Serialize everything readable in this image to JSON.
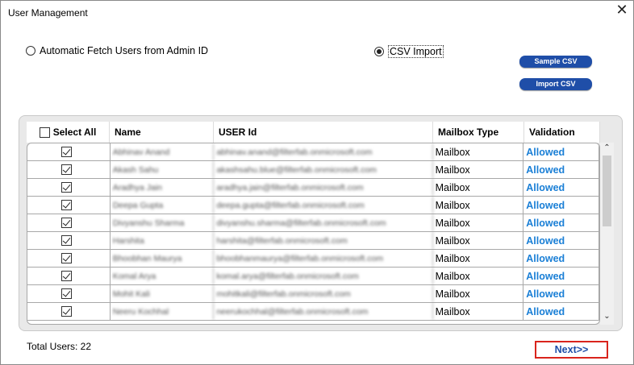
{
  "window": {
    "title": "User Management"
  },
  "options": {
    "auto_fetch_label": "Automatic Fetch Users from Admin ID",
    "csv_import_label": "CSV Import",
    "selected": "csv_import"
  },
  "buttons": {
    "sample_csv": "Sample CSV",
    "import_csv": "Import CSV",
    "next": "Next>>"
  },
  "table": {
    "columns": [
      "Select All",
      "Name",
      "USER Id",
      "Mailbox Type",
      "Validation"
    ],
    "rows": [
      {
        "checked": true,
        "name": "Abhinav Anand",
        "user_id": "abhinav.anand@filterfab.onmicrosoft.com",
        "mailbox_type": "Mailbox",
        "validation": "Allowed"
      },
      {
        "checked": true,
        "name": "Akash Sahu",
        "user_id": "akashsahu.blue@filterfab.onmicrosoft.com",
        "mailbox_type": "Mailbox",
        "validation": "Allowed"
      },
      {
        "checked": true,
        "name": "Aradhya Jain",
        "user_id": "aradhya.jain@filterfab.onmicrosoft.com",
        "mailbox_type": "Mailbox",
        "validation": "Allowed"
      },
      {
        "checked": true,
        "name": "Deepa Gupta",
        "user_id": "deepa.gupta@filterfab.onmicrosoft.com",
        "mailbox_type": "Mailbox",
        "validation": "Allowed"
      },
      {
        "checked": true,
        "name": "Divyanshu Sharma",
        "user_id": "divyanshu.sharma@filterfab.onmicrosoft.com",
        "mailbox_type": "Mailbox",
        "validation": "Allowed"
      },
      {
        "checked": true,
        "name": "Harshita",
        "user_id": "harshita@filterfab.onmicrosoft.com",
        "mailbox_type": "Mailbox",
        "validation": "Allowed"
      },
      {
        "checked": true,
        "name": "Bhoobhan Maurya",
        "user_id": "bhoobhanmaurya@filterfab.onmicrosoft.com",
        "mailbox_type": "Mailbox",
        "validation": "Allowed"
      },
      {
        "checked": true,
        "name": "Komal Arya",
        "user_id": "komal.arya@filterfab.onmicrosoft.com",
        "mailbox_type": "Mailbox",
        "validation": "Allowed"
      },
      {
        "checked": true,
        "name": "Mohit Kali",
        "user_id": "mohitkali@filterfab.onmicrosoft.com",
        "mailbox_type": "Mailbox",
        "validation": "Allowed"
      },
      {
        "checked": true,
        "name": "Neeru Kochhal",
        "user_id": "neerukochhal@filterfab.onmicrosoft.com",
        "mailbox_type": "Mailbox",
        "validation": "Allowed"
      }
    ]
  },
  "footer": {
    "total_users": "Total Users: 22"
  },
  "colors": {
    "accent_blue": "#1f4ea8",
    "allowed_blue": "#1a7fd6",
    "highlight_red": "#d9241c"
  }
}
